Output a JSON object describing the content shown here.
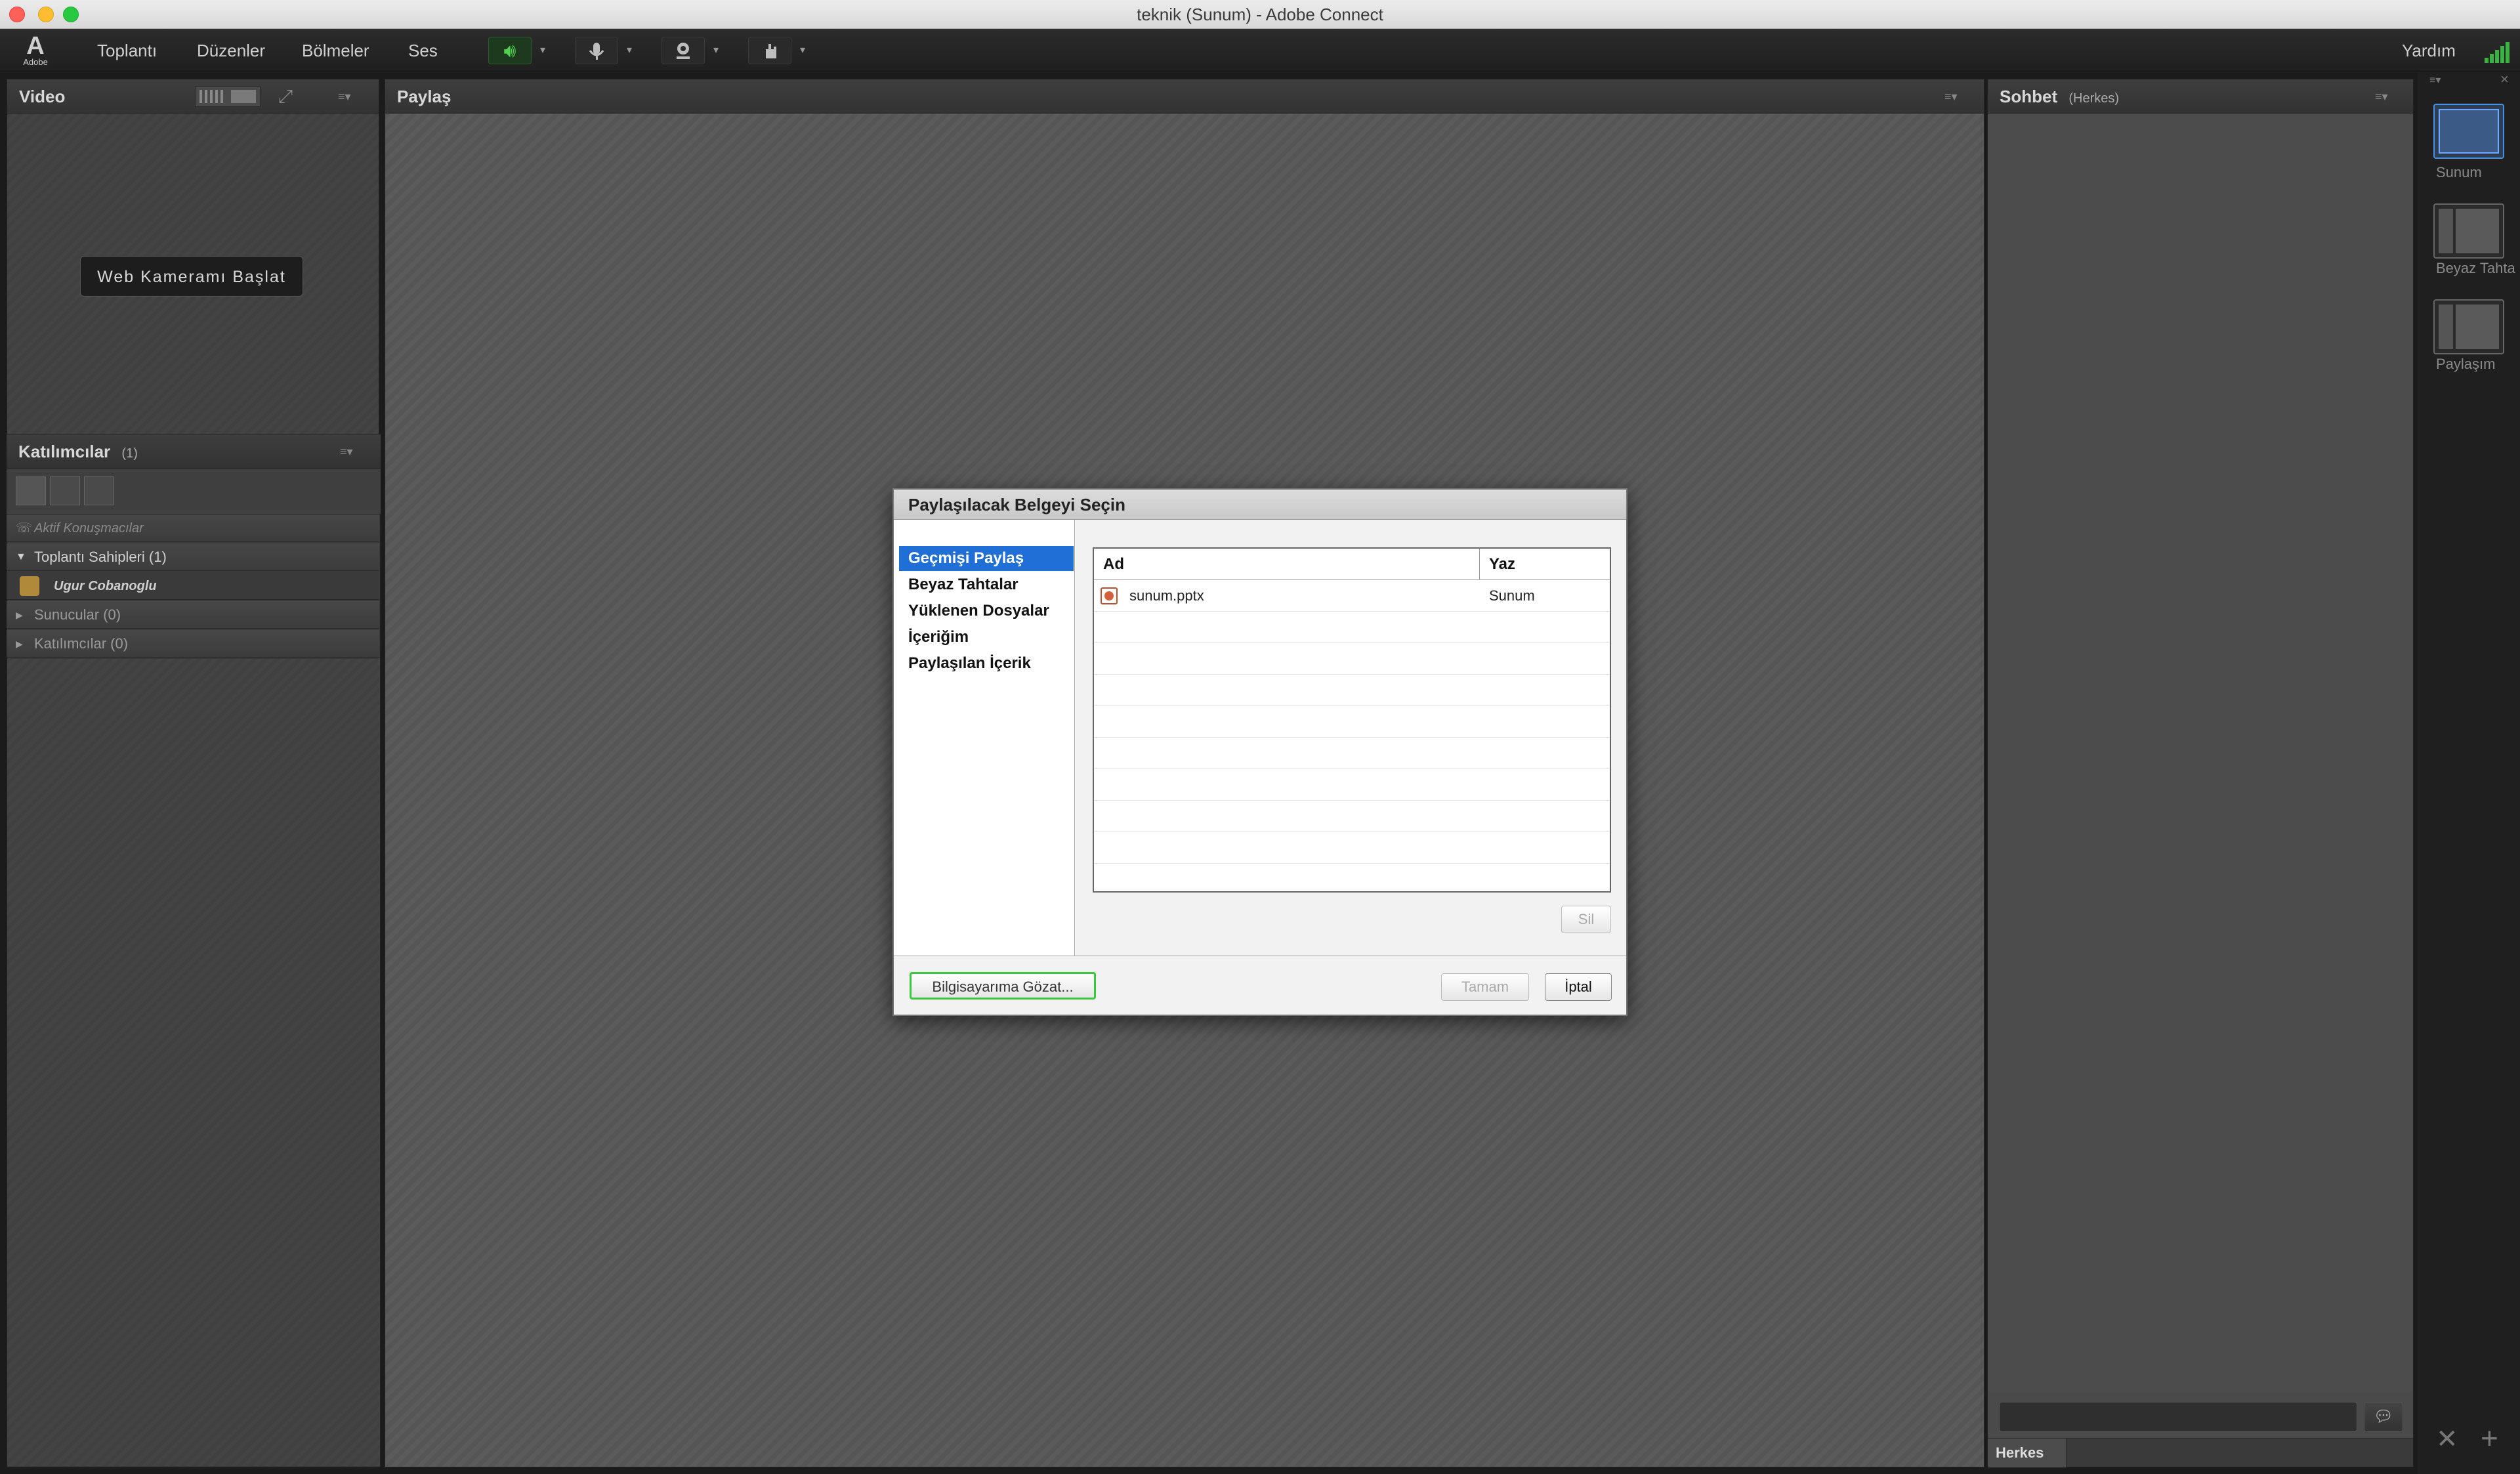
{
  "window": {
    "title": "teknik (Sunum) - Adobe Connect"
  },
  "menubar": {
    "logo_text": "Adobe",
    "items": [
      "Toplantı",
      "Düzenler",
      "Bölmeler",
      "Ses"
    ],
    "help_label": "Yardım"
  },
  "video_pod": {
    "title": "Video",
    "start_webcam_label": "Web Kameramı Başlat"
  },
  "attendees_pod": {
    "title": "Katılımcılar",
    "count": "(1)",
    "active_speakers_label": "Aktif Konuşmacılar",
    "groups": [
      {
        "label": "Toplantı Sahipleri (1)",
        "expanded": true
      },
      {
        "label": "Sunucular (0)",
        "expanded": false
      },
      {
        "label": "Katılımcılar (0)",
        "expanded": false
      }
    ],
    "hosts": [
      "Ugur Cobanoglu"
    ]
  },
  "share_pod": {
    "title": "Paylaş"
  },
  "dialog": {
    "title": "Paylaşılacak Belgeyi Seçin",
    "categories": [
      "Geçmişi Paylaş",
      "Beyaz Tahtalar",
      "Yüklenen Dosyalar",
      "İçeriğim",
      "Paylaşılan İçerik"
    ],
    "selected_category": "Geçmişi Paylaş",
    "table": {
      "columns": [
        "Ad",
        "Yaz"
      ],
      "rows": [
        {
          "name": "sunum.pptx",
          "type": "Sunum"
        }
      ]
    },
    "delete_label": "Sil",
    "browse_label": "Bilgisayarıma Gözat...",
    "ok_label": "Tamam",
    "cancel_label": "İptal"
  },
  "chat_pod": {
    "title": "Sohbet",
    "audience": "(Herkes)",
    "tab_label": "Herkes"
  },
  "layouts": [
    {
      "label": "Sunum",
      "active": true
    },
    {
      "label": "Beyaz Tahta",
      "active": false
    },
    {
      "label": "Paylaşım",
      "active": false
    }
  ],
  "colors": {
    "accent": "#1f6fd6",
    "focus_green": "#3cc83c",
    "signal_green": "#3cb043"
  }
}
